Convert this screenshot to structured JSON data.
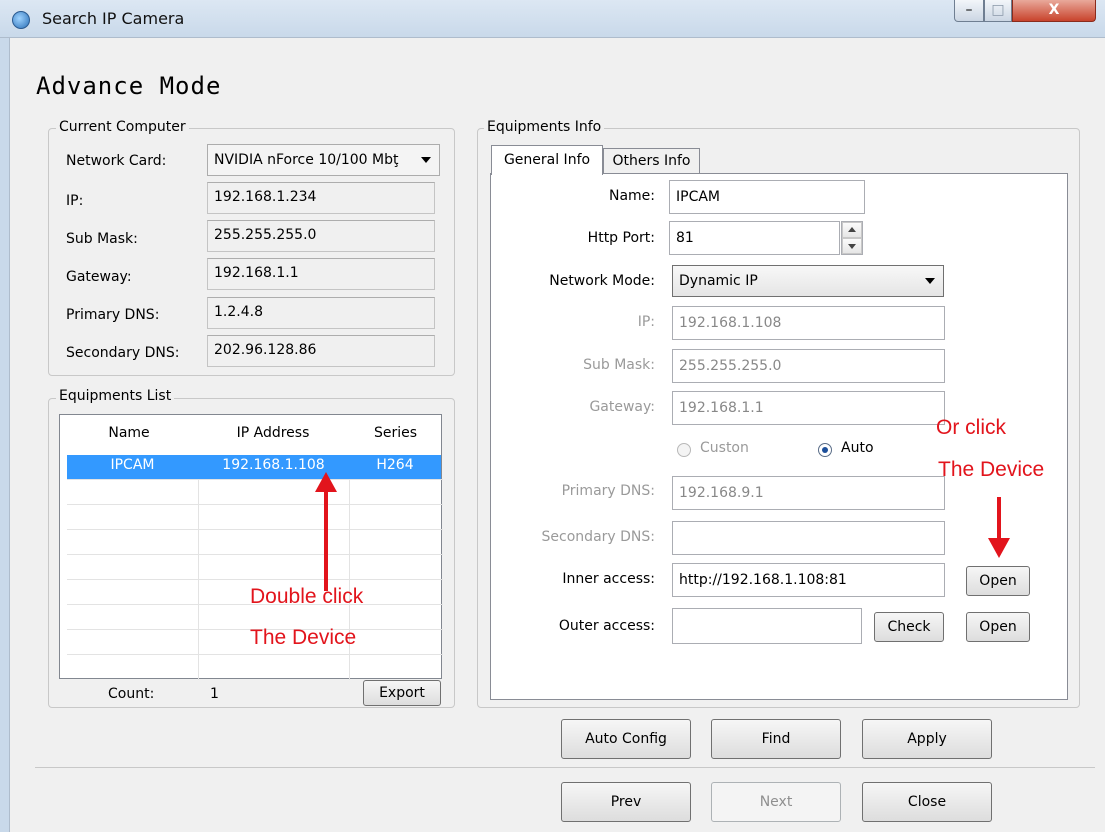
{
  "window": {
    "title": "Search IP Camera",
    "minimize": "–",
    "maximize": "□",
    "close": "X"
  },
  "heading": "Advance Mode",
  "current_computer": {
    "group_label": "Current Computer",
    "network_card_label": "Network Card:",
    "network_card_value": "NVIDIA nForce 10/100 Mbţ",
    "ip_label": "IP:",
    "ip_value": "192.168.1.234",
    "submask_label": "Sub Mask:",
    "submask_value": "255.255.255.0",
    "gateway_label": "Gateway:",
    "gateway_value": "192.168.1.1",
    "primary_dns_label": "Primary DNS:",
    "primary_dns_value": "1.2.4.8",
    "secondary_dns_label": "Secondary DNS:",
    "secondary_dns_value": "202.96.128.86"
  },
  "equipments_list": {
    "group_label": "Equipments List",
    "columns": [
      "Name",
      "IP Address",
      "Series"
    ],
    "rows": [
      {
        "name": "IPCAM",
        "ip": "192.168.1.108",
        "series": "H264"
      }
    ],
    "count_label": "Count:",
    "count_value": "1",
    "export_label": "Export"
  },
  "equipments_info": {
    "group_label": "Equipments Info",
    "tabs": [
      "General Info",
      "Others Info"
    ],
    "name_label": "Name:",
    "name_value": "IPCAM",
    "http_port_label": "Http Port:",
    "http_port_value": "81",
    "network_mode_label": "Network Mode:",
    "network_mode_value": "Dynamic IP",
    "ip_label": "IP:",
    "ip_value": "192.168.1.108",
    "submask_label": "Sub Mask:",
    "submask_value": "255.255.255.0",
    "gateway_label": "Gateway:",
    "gateway_value": "192.168.1.1",
    "radio_custom": "Custon",
    "radio_auto": "Auto",
    "primary_dns_label": "Primary DNS:",
    "primary_dns_value": "192.168.9.1",
    "secondary_dns_label": "Secondary DNS:",
    "secondary_dns_value": "",
    "inner_access_label": "Inner access:",
    "inner_access_value": "http://192.168.1.108:81",
    "outer_access_label": "Outer access:",
    "outer_access_value": "",
    "open_label": "Open",
    "check_label": "Check"
  },
  "actions": {
    "auto_config": "Auto Config",
    "find": "Find",
    "apply": "Apply"
  },
  "nav": {
    "prev": "Prev",
    "next": "Next",
    "close": "Close"
  },
  "annotations": {
    "left_line1": "Double click",
    "left_line2": "The Device",
    "right_line1": "Or click",
    "right_line2": "The Device",
    "color": "#e2141c"
  },
  "colors": {
    "selection": "#3399ff",
    "titlebar": "#c9d9ea"
  }
}
